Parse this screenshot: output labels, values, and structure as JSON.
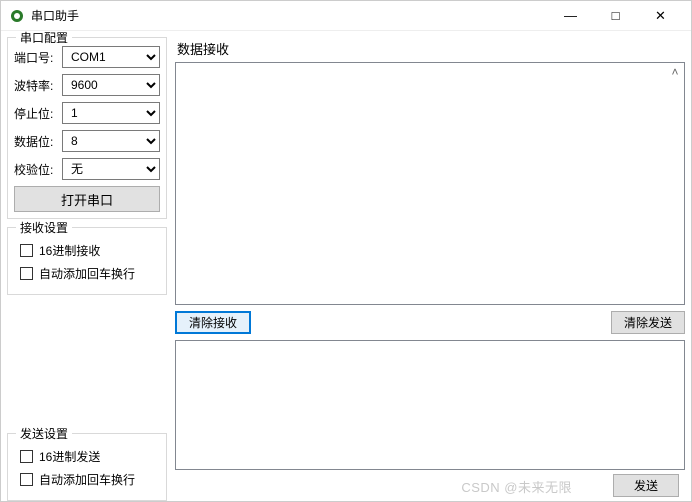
{
  "window": {
    "title": "串口助手"
  },
  "titlebar_controls": {
    "min": "—",
    "max": "□",
    "close": "✕"
  },
  "config": {
    "group_title": "串口配置",
    "port": {
      "label": "端口号:",
      "value": "COM1"
    },
    "baud": {
      "label": "波特率:",
      "value": "9600"
    },
    "stop": {
      "label": "停止位:",
      "value": "1"
    },
    "data": {
      "label": "数据位:",
      "value": "8"
    },
    "parity": {
      "label": "校验位:",
      "value": "无"
    },
    "open_btn": "打开串口"
  },
  "recv_settings": {
    "group_title": "接收设置",
    "hex": "16进制接收",
    "crlf": "自动添加回车换行"
  },
  "send_settings": {
    "group_title": "发送设置",
    "hex": "16进制发送",
    "crlf": "自动添加回车换行"
  },
  "recv": {
    "title": "数据接收"
  },
  "buttons": {
    "clear_recv": "清除接收",
    "clear_send": "清除发送",
    "send": "发送"
  },
  "watermark": "CSDN @未来无限"
}
